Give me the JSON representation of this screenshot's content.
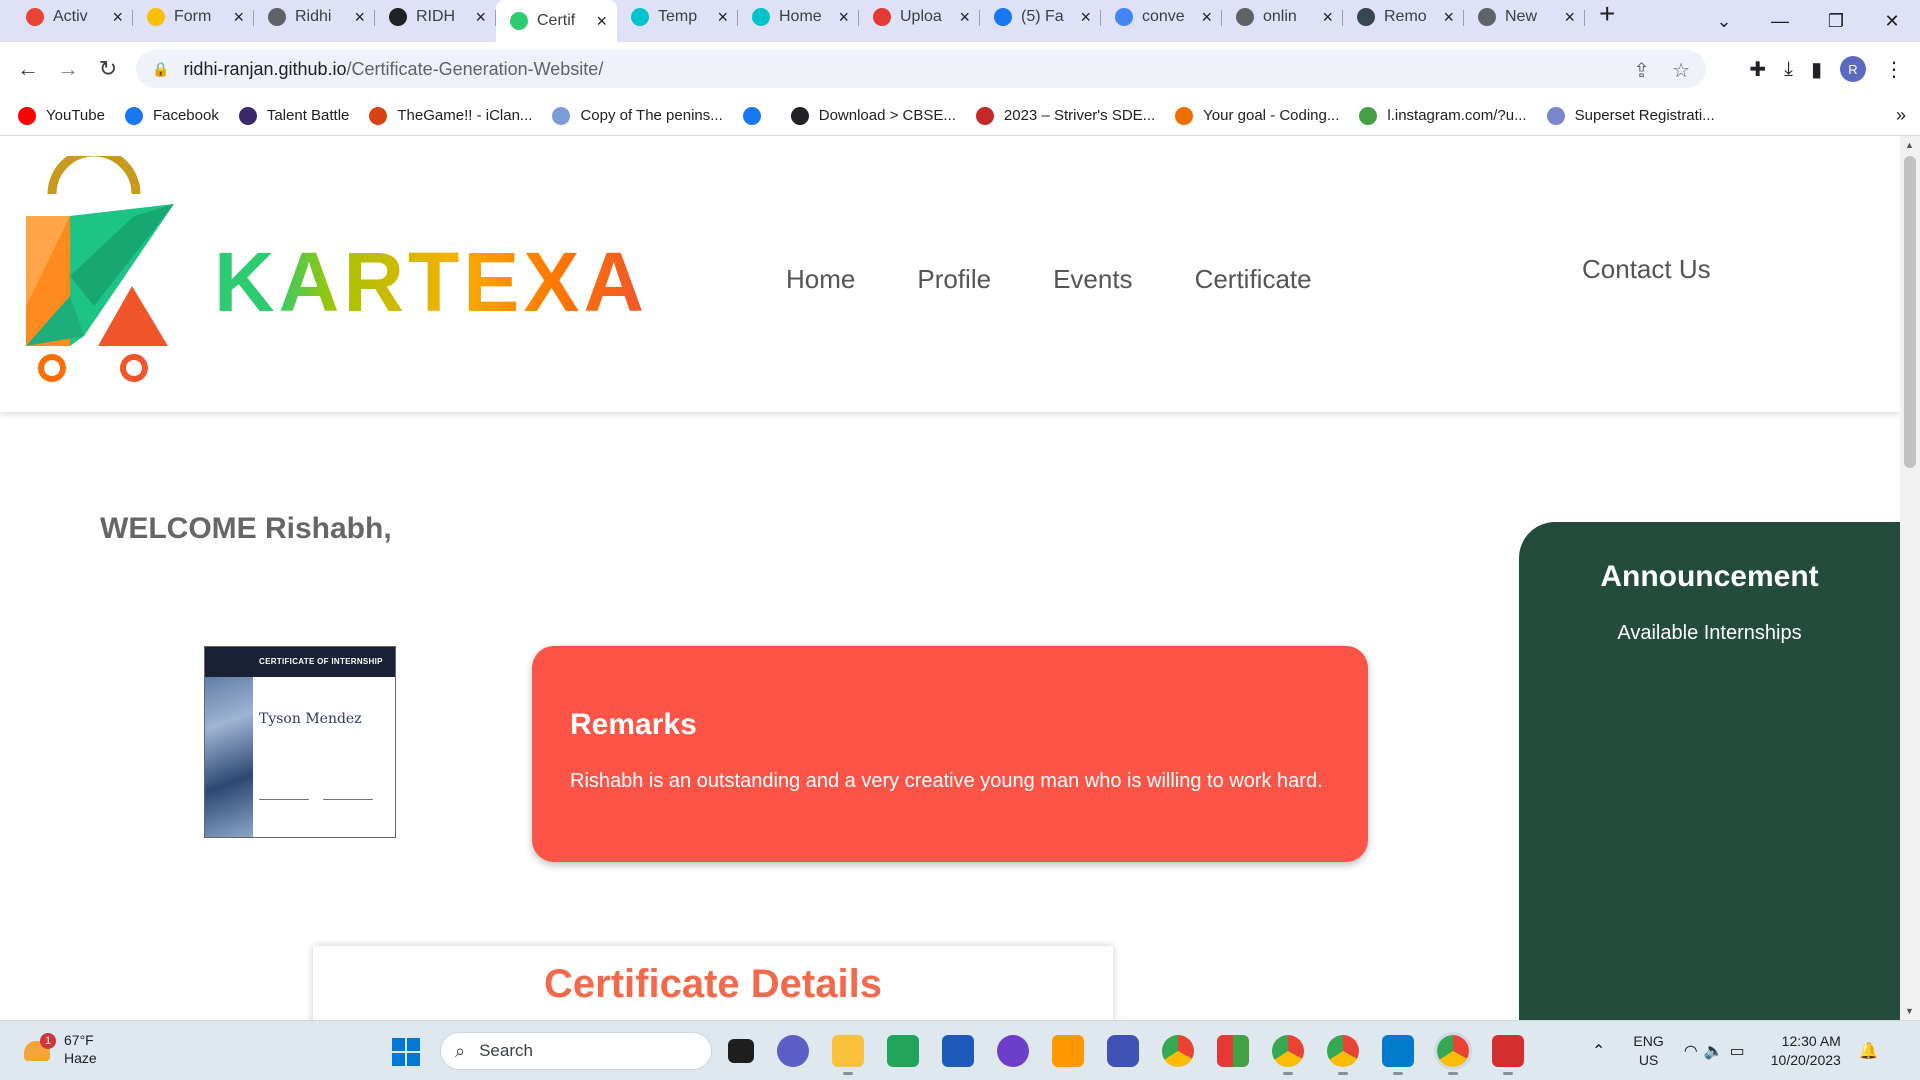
{
  "browser": {
    "tabs": [
      {
        "title": "Activ",
        "icon": "gmail-icon",
        "color": "#ea4335"
      },
      {
        "title": "Form",
        "icon": "coin-icon",
        "color": "#f6c000"
      },
      {
        "title": "Ridhi",
        "icon": "globe-icon",
        "color": "#5f6368"
      },
      {
        "title": "RIDH",
        "icon": "github-icon",
        "color": "#202124"
      },
      {
        "title": "Certif",
        "icon": "kartexa-icon",
        "color": "#2ecc71",
        "active": true
      },
      {
        "title": "Temp",
        "icon": "canva-icon",
        "color": "#00c4cc"
      },
      {
        "title": "Home",
        "icon": "canva-icon",
        "color": "#00c4cc"
      },
      {
        "title": "Uploa",
        "icon": "upload-icon",
        "color": "#e53935"
      },
      {
        "title": "(5) Fa",
        "icon": "facebook-icon",
        "color": "#1877f2"
      },
      {
        "title": "conve",
        "icon": "google-icon",
        "color": "#4285f4"
      },
      {
        "title": "onlin",
        "icon": "globe-icon",
        "color": "#5f6368"
      },
      {
        "title": "Remo",
        "icon": "layers-icon",
        "color": "#37474f"
      },
      {
        "title": "New",
        "icon": "chrome-icon",
        "color": "#5f6368"
      }
    ],
    "url_host": "ridhi-ranjan.github.io",
    "url_path": "/Certificate-Generation-Website/",
    "profile_initial": "R",
    "bookmarks": [
      {
        "label": "YouTube",
        "color": "#ff0000"
      },
      {
        "label": "Facebook",
        "color": "#1877f2"
      },
      {
        "label": "Talent Battle",
        "color": "#3a2a6b"
      },
      {
        "label": "TheGame!! - iClan...",
        "color": "#d84315"
      },
      {
        "label": "Copy of The penins...",
        "color": "#7e9cd8"
      },
      {
        "label": "",
        "color": "#1877f2"
      },
      {
        "label": "Download > CBSE...",
        "color": "#202124"
      },
      {
        "label": "2023 – Striver's SDE...",
        "color": "#c62828"
      },
      {
        "label": "Your goal - Coding...",
        "color": "#ef6c00"
      },
      {
        "label": "l.instagram.com/?u...",
        "color": "#43a047"
      },
      {
        "label": "Superset Registrati...",
        "color": "#7986cb"
      }
    ]
  },
  "site": {
    "brand": "KARTEXA",
    "nav": [
      "Home",
      "Profile",
      "Events",
      "Certificate"
    ],
    "contact": "Contact Us",
    "welcome": "WELCOME Rishabh,",
    "certificate_thumb": {
      "heading": "CERTIFICATE OF INTERNSHIP",
      "name": "Tyson Mendez"
    },
    "remarks": {
      "title": "Remarks",
      "text": "Rishabh is an outstanding and a very creative young man who is willing to work hard."
    },
    "details_title": "Certificate Details",
    "announcement": {
      "title": "Announcement",
      "item": "Available Internships"
    }
  },
  "taskbar": {
    "weather_badge": "1",
    "temperature": "67°F",
    "condition": "Haze",
    "search_label": "Search",
    "language": "ENG",
    "region": "US",
    "time": "12:30 AM",
    "date": "10/20/2023"
  }
}
